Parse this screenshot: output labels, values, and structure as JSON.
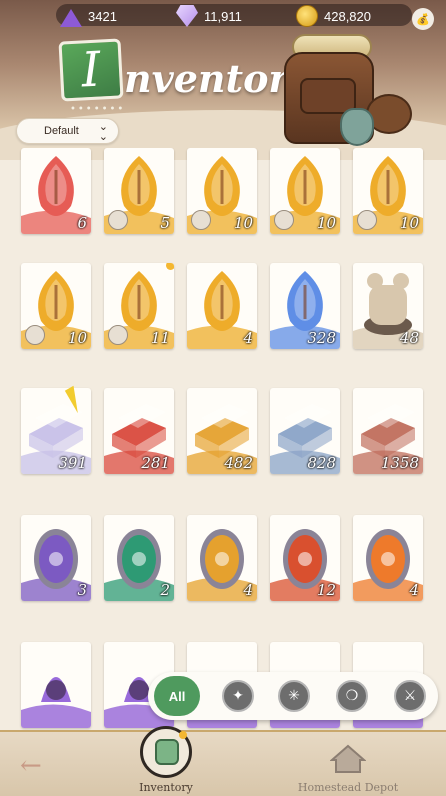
{
  "currencies": [
    {
      "icon": "purple-shard-icon",
      "value": "3421"
    },
    {
      "icon": "diamond-icon",
      "value": "11,911"
    },
    {
      "icon": "gold-coin-icon",
      "value": "428,820"
    }
  ],
  "header": {
    "title_initial": "I",
    "title_rest": "nventory",
    "sort_label": "Default"
  },
  "colors": {
    "accent_green": "#4f9a5e",
    "card_bg": "#fffdf8",
    "notification": "#f4b731"
  },
  "rows": [
    {
      "kind": "red-gold-feather-sigils",
      "items": [
        {
          "color": "#e65c55",
          "count": "6",
          "sub": false
        },
        {
          "color": "#eeac2a",
          "count": "5",
          "sub": true
        },
        {
          "color": "#eeac2a",
          "count": "10",
          "sub": true
        },
        {
          "color": "#eeac2a",
          "count": "10",
          "sub": true
        },
        {
          "color": "#eeac2a",
          "count": "10",
          "sub": true
        }
      ]
    },
    {
      "kind": "gold-blue-sigils-and-statue",
      "items": [
        {
          "color": "#eeac2a",
          "count": "10",
          "sub": true
        },
        {
          "color": "#eeac2a",
          "count": "11",
          "sub": true,
          "dot": true
        },
        {
          "color": "#eeac2a",
          "count": "4",
          "sub": false
        },
        {
          "color": "#5f8ee6",
          "count": "328",
          "sub": false
        },
        {
          "color": "#d8c7ad",
          "count": "48",
          "sub": false
        }
      ]
    },
    {
      "kind": "ingots",
      "items": [
        {
          "color": "#c7c0e8",
          "count": "391"
        },
        {
          "color": "#d94a3d",
          "count": "281"
        },
        {
          "color": "#e5a12e",
          "count": "482"
        },
        {
          "color": "#8aa3c7",
          "count": "828"
        },
        {
          "color": "#c06e5c",
          "count": "1358"
        }
      ]
    },
    {
      "kind": "emblems",
      "items": [
        {
          "color": "#7c5ac2",
          "count": "3"
        },
        {
          "color": "#2e9a74",
          "count": "2"
        },
        {
          "color": "#e5a12e",
          "count": "4"
        },
        {
          "color": "#d9502f",
          "count": "12"
        },
        {
          "color": "#ee7a2b",
          "count": "4"
        }
      ]
    },
    {
      "kind": "partial-row",
      "items": [
        {
          "color": "#8d5ad6",
          "count": ""
        },
        {
          "color": "#8d5ad6",
          "count": ""
        },
        {
          "color": "#8d5ad6",
          "count": ""
        },
        {
          "color": "#8d5ad6",
          "count": ""
        },
        {
          "color": "#8d5ad6",
          "count": ""
        }
      ]
    }
  ],
  "filters": {
    "all_label": "All",
    "icons": [
      "blade-icon",
      "compass-rose-icon",
      "compass-icon",
      "sword-icon"
    ]
  },
  "bottom_nav": {
    "inventory_label": "Inventory",
    "depot_label": "Homestead Depot"
  }
}
